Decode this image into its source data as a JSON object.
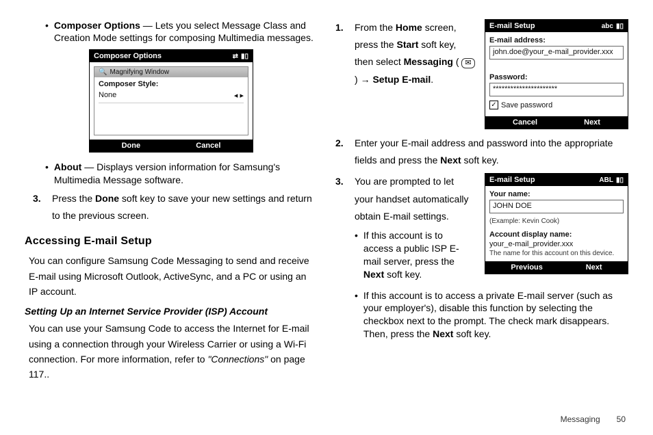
{
  "left": {
    "composer_bullet_label": "Composer Options",
    "composer_bullet_text": " — Lets you select Message Class and Creation Mode settings for composing Multimedia messages.",
    "shot": {
      "title": "Composer Options",
      "signal_icon": "⇄",
      "bars_icon": "▮▯",
      "win_title": "Magnifying Window",
      "style_label": "Composer Style:",
      "style_value": "None",
      "done": "Done",
      "cancel": "Cancel"
    },
    "about_label": "About",
    "about_text": " — Displays version information for Samsung's Multimedia Message software.",
    "step3_num": "3.",
    "step3_a": "Press the ",
    "step3_done": "Done",
    "step3_b": " soft key to save your new settings and return to the previous screen.",
    "h2": "Accessing E-mail Setup",
    "p1": "You can configure Samsung Code Messaging to send and receive E-mail using Microsoft Outlook, ActiveSync, and a PC or using an IP account.",
    "h3": "Setting Up an Internet Service Provider (ISP) Account",
    "p2_a": "You can use your Samsung Code to access the Internet for E-mail using a connection through your Wireless Carrier or using a Wi-Fi connection. For more information, refer to ",
    "p2_ref": "\"Connections\"",
    "p2_b": "  on page 117.."
  },
  "right": {
    "step1": {
      "num": "1.",
      "a": "From the ",
      "home": "Home",
      "b": " screen, press the ",
      "start": "Start",
      "c": " soft key, then select ",
      "messaging": "Messaging",
      "d": " ( ",
      "icon": "✉",
      "e": " ) ",
      "arrow": "→",
      "setup": " Setup E-mail",
      "f": "."
    },
    "shot1": {
      "title": "E-mail Setup",
      "mode": "abc",
      "sig": "▮▯",
      "addr_label": "E-mail address:",
      "addr_value": "john.doe@your_e-mail_provider.xxx",
      "pw_label": "Password:",
      "pw_value": "**********************",
      "save_pw": "Save password",
      "cancel": "Cancel",
      "next": "Next"
    },
    "step2": {
      "num": "2.",
      "a": "Enter your E-mail address and password into the appropriate fields and press the ",
      "next": "Next",
      "b": " soft key."
    },
    "step3": {
      "num": "3.",
      "txt": "You are prompted to let your handset automatically obtain E-mail settings."
    },
    "shot2": {
      "title": "E-mail Setup",
      "mode": "ABL",
      "sig": "▮▯",
      "name_label": "Your name:",
      "name_value": "JOHN DOE",
      "name_example": "(Example: Kevin Cook)",
      "disp_label": "Account display name:",
      "disp_value": "your_e-mail_provider.xxx",
      "disp_hint": "The name for this account on this device.",
      "prev": "Previous",
      "next": "Next"
    },
    "sub_bullet1_a": "If this account is to access a public ISP E-mail server, press the ",
    "sub_bullet1_next": "Next",
    "sub_bullet1_b": " soft key.",
    "sub_bullet2_a": "If this account is to access a private E-mail server (such as your employer's), disable this function by selecting the checkbox next to the prompt. The check mark disappears. Then, press the ",
    "sub_bullet2_next": "Next",
    "sub_bullet2_b": " soft key."
  },
  "footer": {
    "section": "Messaging",
    "page": "50"
  }
}
